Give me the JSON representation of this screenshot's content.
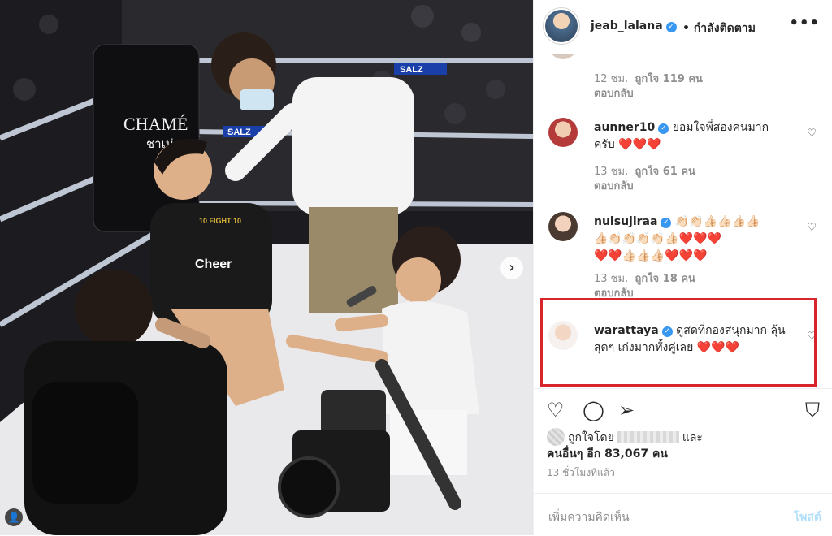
{
  "post": {
    "username": "jeab_lalana",
    "follow_status": "• กำลังติดตาม",
    "more_icon": "•••"
  },
  "photo": {
    "ring_signs": [
      "CHAMÉ",
      "ชาเม่",
      "SALZ",
      "SALZ"
    ],
    "shirt_text": "Cheer",
    "shirt_logo": "10 FIGHT 10"
  },
  "comments": [
    {
      "meta_time": "12 ชม.",
      "meta_likes": "ถูกใจ 119 คน",
      "reply": "ตอบกลับ"
    },
    {
      "username": "aunner10",
      "text": "ยอมใจพี่สองคนมากครับ",
      "emoji": "❤️❤️❤️",
      "meta_time": "13 ชม.",
      "meta_likes": "ถูกใจ 61 คน",
      "reply": "ตอบกลับ"
    },
    {
      "username": "nuisujiraa",
      "emoji_line1": "👏🏻👏🏻👍🏻👍🏻👍🏻👍🏻",
      "emoji_line2": "👍🏻👏🏻👏🏻👏🏻👏🏻👍🏻❤️❤️❤️",
      "emoji_line3": "❤️❤️👍🏻👍🏻👍🏻❤️❤️❤️",
      "meta_time": "13 ชม.",
      "meta_likes": "ถูกใจ 18 คน",
      "reply": "ตอบกลับ"
    },
    {
      "username": "warattaya",
      "text": "ดูสดที่กองสนุกมาก ลุ้นสุดๆ เก่งมากทั้งคู่เลย",
      "emoji": "❤️❤️❤️"
    }
  ],
  "likes": {
    "prefix": "ถูกใจโดย",
    "and": "และ",
    "others": "คนอื่นๆ อีก 83,067 คน"
  },
  "timestamp": "13 ชั่วโมงที่แล้ว",
  "add_comment": {
    "placeholder": "เพิ่มความคิดเห็น",
    "post_label": "โพสต์"
  },
  "colors": {
    "highlight_border": "#d7262b",
    "verified": "#3897f0",
    "post_button": "#b2dffc"
  }
}
